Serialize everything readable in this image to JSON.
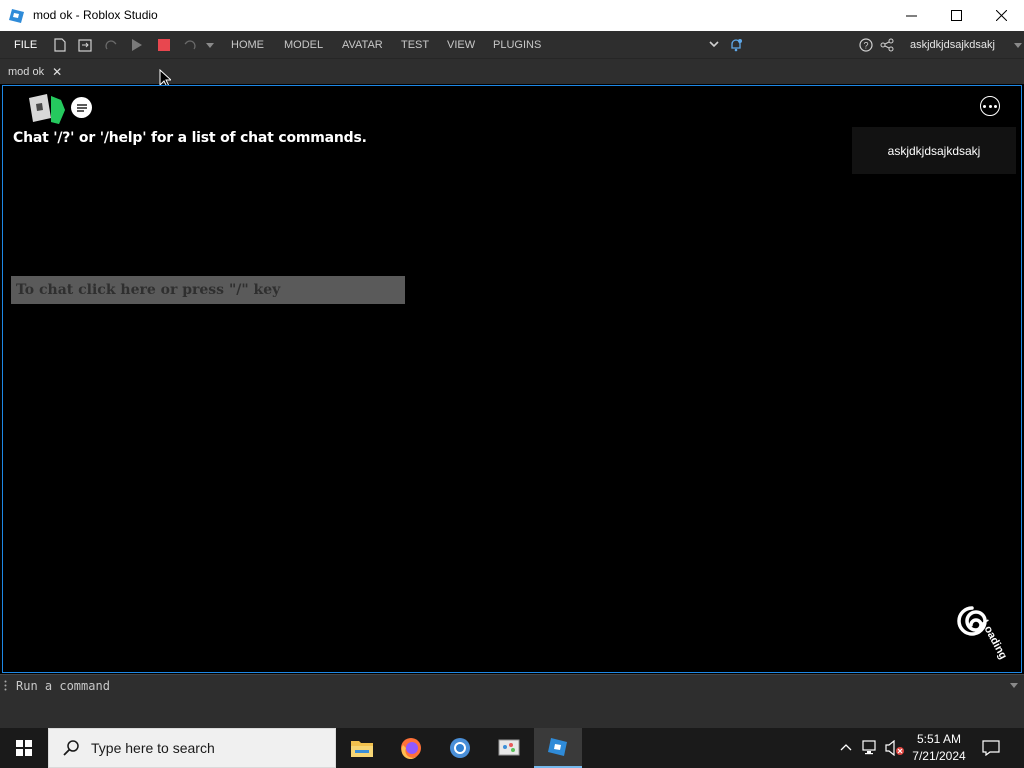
{
  "window": {
    "title": "mod ok - Roblox Studio"
  },
  "ribbon": {
    "file": "FILE",
    "tabs": [
      "HOME",
      "MODEL",
      "AVATAR",
      "TEST",
      "VIEW",
      "PLUGINS"
    ],
    "username": "askjdkjdsajkdsakj"
  },
  "doc_tab": {
    "label": "mod ok",
    "close": "✕"
  },
  "viewport": {
    "chat_message": "Chat '/?' or '/help' for a list of chat commands.",
    "chat_placeholder": "To chat click here or press \"/\" key",
    "player_list": [
      "askjdkjdsajkdsakj"
    ],
    "loading_label": "Loading"
  },
  "command_bar": {
    "placeholder": "Run a command"
  },
  "taskbar": {
    "search_placeholder": "Type here to search",
    "time": "5:51 AM",
    "date": "7/21/2024"
  },
  "colors": {
    "accent": "#1e88e5",
    "stop": "#e8474f",
    "ribbon_bg": "#2e2e2e"
  }
}
